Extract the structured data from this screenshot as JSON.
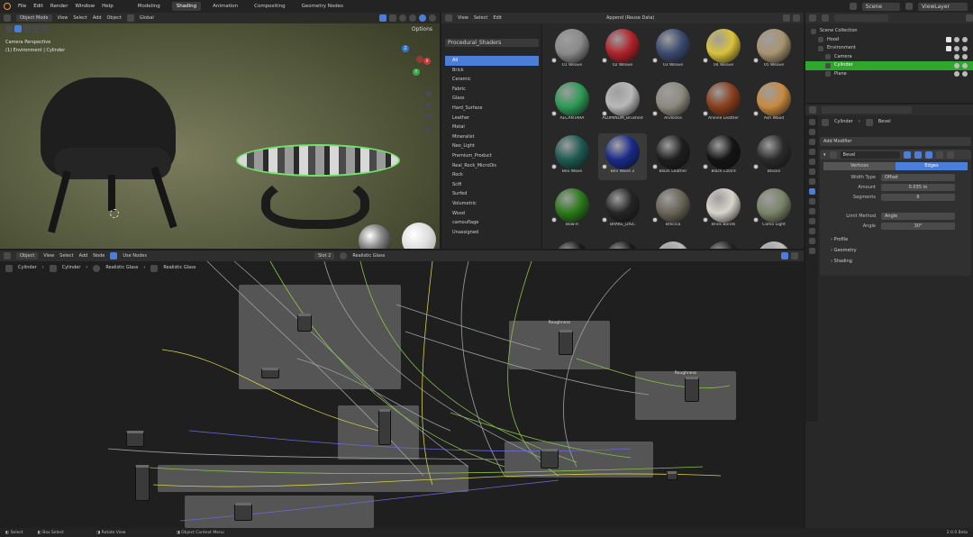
{
  "menubar": {
    "menus": [
      "File",
      "Edit",
      "Render",
      "Window",
      "Help"
    ],
    "workspaces": [
      "Modeling",
      "Shading",
      "Animation",
      "Compositing",
      "Geometry Nodes"
    ],
    "active_workspace": "Shading",
    "scene": "Scene",
    "view_layer": "ViewLayer"
  },
  "viewport": {
    "mode": "Object Mode",
    "menus": [
      "View",
      "Select",
      "Add",
      "Object"
    ],
    "transform": "Global",
    "overlay_title": "Camera Perspective",
    "overlay_subtitle": "(1) Environment | Cylinder",
    "options_label": "Options",
    "gizmo": {
      "x": "X",
      "y": "Y",
      "z": "Z"
    }
  },
  "asset_browser": {
    "menus": [
      "View",
      "Select",
      "Edit"
    ],
    "import_mode": "Append (Reuse Data)",
    "library": "Procedural_Shaders",
    "categories": [
      "All",
      "Brick",
      "Ceramic",
      "Fabric",
      "Glass",
      "Hard_Surface",
      "Leather",
      "Metal",
      "Mineralist",
      "Neo_Light",
      "Premium_Product",
      "Real_Rock_MicroDis",
      "Rock",
      "Scifi",
      "Surfed",
      "Volumetric",
      "Wood",
      "camouflage",
      "Unassigned"
    ],
    "active_category": "All",
    "assets": [
      {
        "name": "01 Weave",
        "color": "#8a8a8a"
      },
      {
        "name": "02 Weave",
        "color": "#b0222a"
      },
      {
        "name": "03 Weave",
        "color": "#3a4a6e"
      },
      {
        "name": "04 Weave",
        "color": "#d9c23a"
      },
      {
        "name": "05 Weave",
        "color": "#a89470"
      },
      {
        "name": "ALCANTARA",
        "color": "#2e9a55"
      },
      {
        "name": "ALUMINUM_Brushed",
        "color": "#b8b8b8"
      },
      {
        "name": "Andesite",
        "color": "#8e8a80"
      },
      {
        "name": "Aniline Leather",
        "color": "#8a3e1c"
      },
      {
        "name": "Ash Wood",
        "color": "#c88a40"
      },
      {
        "name": "Bev Wave",
        "color": "#1e5a52"
      },
      {
        "name": "Bev Wave 2",
        "color": "#1a2a8a"
      },
      {
        "name": "Black Leather",
        "color": "#1e1e1e"
      },
      {
        "name": "Black Lizard",
        "color": "#141414"
      },
      {
        "name": "Blocks",
        "color": "#2a2a2a"
      },
      {
        "name": "Bow-R",
        "color": "#2a7a1a"
      },
      {
        "name": "BRAKE_DISC",
        "color": "#242424"
      },
      {
        "name": "Breccia",
        "color": "#6a6458"
      },
      {
        "name": "Brick Bonds",
        "color": "#d8d4cc"
      },
      {
        "name": "Camo Light",
        "color": "#7a8468"
      },
      {
        "name": "",
        "color": "#1a1a1a"
      },
      {
        "name": "",
        "color": "#1a1a1a"
      },
      {
        "name": "",
        "color": "#bcbcbc"
      },
      {
        "name": "",
        "color": "#202020"
      },
      {
        "name": "",
        "color": "#c0c0c0"
      }
    ],
    "selected_asset": "Bev Wave 2"
  },
  "outliner": {
    "items": [
      {
        "label": "Scene Collection",
        "indent": 0
      },
      {
        "label": "Hood",
        "indent": 1
      },
      {
        "label": "Environment",
        "indent": 1
      },
      {
        "label": "Camera",
        "indent": 2
      },
      {
        "label": "Cylinder",
        "indent": 2
      },
      {
        "label": "Plane",
        "indent": 2
      }
    ],
    "selected": "Cylinder"
  },
  "properties": {
    "breadcrumb_object": "Cylinder",
    "breadcrumb_modifier": "Bevel",
    "add_modifier": "Add Modifier",
    "modifier_name": "Bevel",
    "tabs": [
      "Vertices",
      "Edges"
    ],
    "active_tab": "Edges",
    "fields": [
      {
        "label": "Width Type",
        "value": "Offset"
      },
      {
        "label": "Amount",
        "value": "0.035 m"
      },
      {
        "label": "Segments",
        "value": "6"
      },
      {
        "label": "Limit Method",
        "value": "Angle"
      },
      {
        "label": "Angle",
        "value": "30°"
      }
    ],
    "subpanels": [
      "Profile",
      "Geometry",
      "Shading"
    ]
  },
  "node_editor": {
    "menus": [
      "View",
      "Select",
      "Add",
      "Node"
    ],
    "mode": "Object",
    "use_nodes_label": "Use Nodes",
    "slot": "Slot 2",
    "material": "Realistic Glass",
    "breadcrumbs": [
      "Cylinder",
      "Cylinder",
      "Realistic Glass",
      "Realistic Glass"
    ],
    "frame_labels": [
      "Roughness",
      "Roughness"
    ]
  },
  "statusbar": {
    "items": [
      "Select",
      "Box Select",
      "Rotate View",
      "Object Context Menu"
    ],
    "version": "2.0.0 Beta"
  },
  "colors": {
    "accent": "#4a7ed8",
    "selection": "#2fa72c",
    "outline": "#6fe36a",
    "brand": "#e89a3c"
  }
}
